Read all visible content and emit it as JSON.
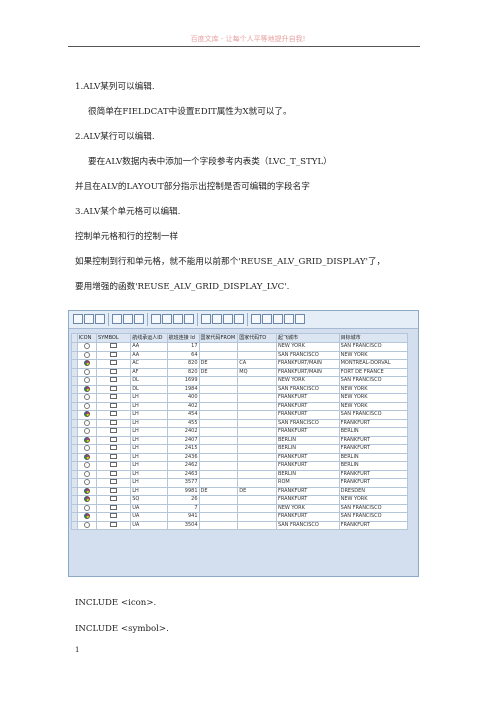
{
  "header": "百度文库 - 让每个人平等地提升自我!",
  "paragraphs": {
    "p1": "1.ALV某列可以编辑.",
    "p2": "很简单在FIELDCAT中设置EDIT属性为X就可以了。",
    "p3": "2.ALV某行可以编辑.",
    "p4": "要在ALV数据内表中添加一个字段参考内表类（LVC_T_STYL）",
    "p5": "并且在ALV的LAYOUT部分指示出控制是否可编辑的字段名字",
    "p6": "3.ALV某个单元格可以编辑.",
    "p7": "控制单元格和行的控制一样",
    "p8": "如果控制到行和单元格，就不能用以前那个'REUSE_ALV_GRID_DISPLAY'了，",
    "p9": "要用增强的函数'REUSE_ALV_GRID_DISPLAY_LVC'.",
    "p10": "INCLUDE <icon>.",
    "p11": "INCLUDE <symbol>."
  },
  "footer_mark": "1",
  "grid": {
    "columns": [
      "ICON",
      "SYMBOL",
      "航线承运人ID",
      "航班连接 Id",
      "国家代码FROM",
      "国家代码TO",
      "起飞城市",
      "目标城市"
    ],
    "rows": [
      {
        "icon": "clock",
        "sym": "arrow",
        "c": "AA",
        "id": "17",
        "from": "",
        "to": "",
        "dep": "NEW YORK",
        "dest": "SAN FRANCISCO"
      },
      {
        "icon": "clock",
        "sym": "arrow",
        "c": "AA",
        "id": "64",
        "from": "",
        "to": "",
        "dep": "SAN FRANCISCO",
        "dest": "NEW YORK"
      },
      {
        "icon": "color",
        "sym": "box",
        "c": "AC",
        "id": "820",
        "from": "DE",
        "to": "CA",
        "dep": "FRANKFURT/MAIN",
        "dest": "MONTREAL-DORVAL"
      },
      {
        "icon": "clock",
        "sym": "arrow",
        "c": "AF",
        "id": "820",
        "from": "DE",
        "to": "MQ",
        "dep": "FRANKFURT/MAIN",
        "dest": "FORT DE FRANCE"
      },
      {
        "icon": "clock",
        "sym": "arrow",
        "c": "DL",
        "id": "1699",
        "from": "",
        "to": "",
        "dep": "NEW YORK",
        "dest": "SAN FRANCISCO"
      },
      {
        "icon": "color",
        "sym": "box",
        "c": "DL",
        "id": "1984",
        "from": "",
        "to": "",
        "dep": "SAN FRANCISCO",
        "dest": "NEW YORK"
      },
      {
        "icon": "clock",
        "sym": "arrow",
        "c": "LH",
        "id": "400",
        "from": "",
        "to": "",
        "dep": "FRANKFURT",
        "dest": "NEW YORK"
      },
      {
        "icon": "clock",
        "sym": "arrow",
        "c": "LH",
        "id": "402",
        "from": "",
        "to": "",
        "dep": "FRANKFURT",
        "dest": "NEW YORK"
      },
      {
        "icon": "color",
        "sym": "arrow",
        "c": "LH",
        "id": "454",
        "from": "",
        "to": "",
        "dep": "FRANKFURT",
        "dest": "SAN FRANCISCO"
      },
      {
        "icon": "clock",
        "sym": "arrow",
        "c": "LH",
        "id": "455",
        "from": "",
        "to": "",
        "dep": "SAN FRANCISCO",
        "dest": "FRANKFURT"
      },
      {
        "icon": "clock",
        "sym": "arrow",
        "c": "LH",
        "id": "2402",
        "from": "",
        "to": "",
        "dep": "FRANKFURT",
        "dest": "BERLIN"
      },
      {
        "icon": "color",
        "sym": "box",
        "c": "LH",
        "id": "2407",
        "from": "",
        "to": "",
        "dep": "BERLIN",
        "dest": "FRANKFURT"
      },
      {
        "icon": "clock",
        "sym": "arrow",
        "c": "LH",
        "id": "2415",
        "from": "",
        "to": "",
        "dep": "BERLIN",
        "dest": "FRANKFURT"
      },
      {
        "icon": "color",
        "sym": "box",
        "c": "LH",
        "id": "2436",
        "from": "",
        "to": "",
        "dep": "FRANKFURT",
        "dest": "BERLIN"
      },
      {
        "icon": "clock",
        "sym": "box",
        "c": "LH",
        "id": "2462",
        "from": "",
        "to": "",
        "dep": "FRANKFURT",
        "dest": "BERLIN"
      },
      {
        "icon": "clock",
        "sym": "arrow",
        "c": "LH",
        "id": "2463",
        "from": "",
        "to": "",
        "dep": "BERLIN",
        "dest": "FRANKFURT"
      },
      {
        "icon": "clock",
        "sym": "arrow",
        "c": "LH",
        "id": "3577",
        "from": "",
        "to": "",
        "dep": "ROM",
        "dest": "FRANKFURT"
      },
      {
        "icon": "color",
        "sym": "box",
        "c": "LH",
        "id": "9981",
        "from": "DE",
        "to": "DE",
        "dep": "FRANKFURT",
        "dest": "DRESDEN"
      },
      {
        "icon": "color",
        "sym": "arrow",
        "c": "SQ",
        "id": "26",
        "from": "",
        "to": "",
        "dep": "FRANKFURT",
        "dest": "NEW YORK"
      },
      {
        "icon": "clock",
        "sym": "arrow",
        "c": "UA",
        "id": "7",
        "from": "",
        "to": "",
        "dep": "NEW YORK",
        "dest": "SAN FRANCISCO"
      },
      {
        "icon": "color",
        "sym": "arrow",
        "c": "UA",
        "id": "941",
        "from": "",
        "to": "",
        "dep": "FRANKFURT",
        "dest": "SAN FRANCISCO"
      },
      {
        "icon": "clock",
        "sym": "arrow",
        "c": "UA",
        "id": "3504",
        "from": "",
        "to": "",
        "dep": "SAN FRANCISCO",
        "dest": "FRANKFURT"
      }
    ]
  }
}
